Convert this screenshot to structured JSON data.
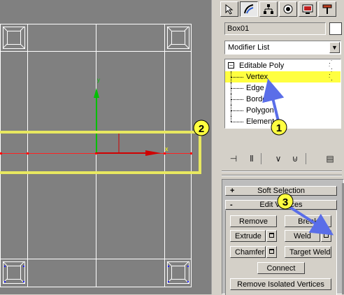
{
  "command_panel": {
    "tabs": [
      {
        "icon": "create-arrow-icon"
      },
      {
        "icon": "modify-curve-icon"
      },
      {
        "icon": "hierarchy-icon"
      },
      {
        "icon": "motion-icon"
      },
      {
        "icon": "display-icon"
      },
      {
        "icon": "utilities-hammer-icon"
      }
    ],
    "object_name": "Box01",
    "object_color": "#ffffff",
    "modifier_list": "Modifier List",
    "stack": {
      "root": "Editable Poly",
      "root_expander": "⊟",
      "items": [
        "Vertex",
        "Edge",
        "Border",
        "Polygon",
        "Element"
      ],
      "selected": "Vertex",
      "highlight_color": "#ffff40"
    },
    "stack_toolbar": [
      "pin-stack-icon",
      "show-end-result-icon",
      "make-unique-icon",
      "remove-modifier-icon",
      "configure-sets-icon"
    ]
  },
  "rollouts": {
    "soft_selection": {
      "sign": "+",
      "label": "Soft Selection"
    },
    "edit_vertices": {
      "sign": "-",
      "label": "Edit Vertices"
    },
    "buttons": {
      "remove": "Remove",
      "break": "Break",
      "extrude": "Extrude",
      "weld": "Weld",
      "chamfer": "Chamfer",
      "target_weld": "Target Weld",
      "connect": "Connect",
      "remove_isolated": "Remove Isolated Vertices"
    }
  },
  "annotations": {
    "badges": [
      "1",
      "2",
      "3"
    ],
    "badge_color": "#ffff40",
    "arrow_color": "#5a6ee8",
    "highlight_color": "#e8e860"
  },
  "viewport": {
    "background": "#808080",
    "wire_color": "#ffffff",
    "axis_labels": {
      "x": "x",
      "y": "y"
    }
  }
}
